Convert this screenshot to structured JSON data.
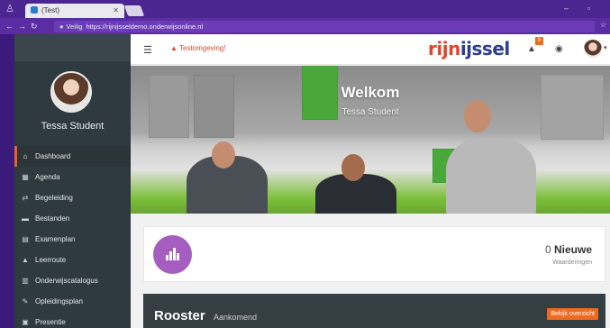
{
  "browser": {
    "tab_title": "(Test)",
    "url_secure_label": "Veilig",
    "url": "https://rijnijsseldemo.onderwijsonline.nl"
  },
  "header": {
    "env_warning": "Testomgeving!",
    "logo_part1": "rijn",
    "logo_part2": "ijssel",
    "notification_count": "8"
  },
  "sidebar": {
    "user_name": "Tessa Student",
    "items": [
      {
        "label": "Dashboard",
        "icon": "home-icon",
        "glyph": "⌂"
      },
      {
        "label": "Agenda",
        "icon": "calendar-icon",
        "glyph": "▦"
      },
      {
        "label": "Begeleiding",
        "icon": "link-icon",
        "glyph": "⇄"
      },
      {
        "label": "Bestanden",
        "icon": "folder-icon",
        "glyph": "▬"
      },
      {
        "label": "Examenplan",
        "icon": "book-icon",
        "glyph": "▤"
      },
      {
        "label": "Leerroute",
        "icon": "chart-icon",
        "glyph": "▲"
      },
      {
        "label": "Onderwijscatalogus",
        "icon": "columns-icon",
        "glyph": "▥"
      },
      {
        "label": "Opleidingsplan",
        "icon": "pencil-icon",
        "glyph": "✎"
      },
      {
        "label": "Presentie",
        "icon": "grid-icon",
        "glyph": "▣"
      }
    ]
  },
  "hero": {
    "title": "Welkom",
    "subtitle": "Tessa Student"
  },
  "stat_card": {
    "count": "0",
    "count_label": "Nieuwe",
    "label": "Waarderingen"
  },
  "rooster": {
    "title": "Rooster",
    "subtitle": "Aankomend",
    "button": "Bekijk overzicht"
  },
  "colors": {
    "accent": "#ef6a1f",
    "sidebar": "#2f3a40",
    "purple_icon": "#a65dc0"
  }
}
